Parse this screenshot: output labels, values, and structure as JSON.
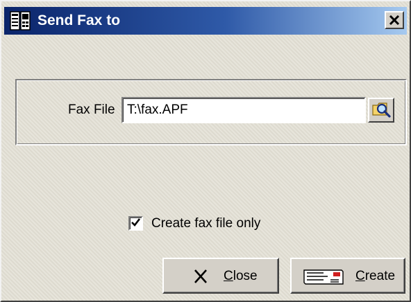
{
  "window": {
    "title": "Send Fax to",
    "icons": {
      "app": "fax-document-icon",
      "close": "close-x-icon"
    }
  },
  "fax_file": {
    "label": "Fax File",
    "value": "T:\\fax.APF",
    "browse_icon": "magnifier-folder-icon"
  },
  "options": {
    "create_only": {
      "label": "Create fax file only",
      "checked": true
    }
  },
  "buttons": {
    "close": {
      "mnemonic": "C",
      "rest": "lose",
      "icon": "x-icon"
    },
    "create": {
      "mnemonic": "C",
      "rest": "reate",
      "icon": "fax-machine-icon"
    }
  },
  "colors": {
    "title_gradient_start": "#0a246a",
    "title_gradient_end": "#a6caf0",
    "face": "#d4d0c8"
  }
}
